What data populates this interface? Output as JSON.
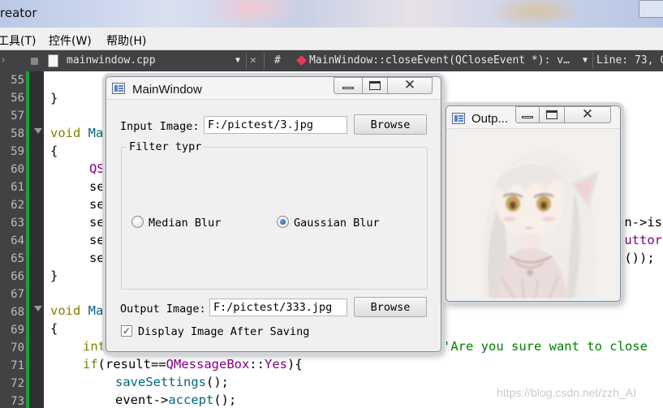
{
  "creator_window": {
    "title": "reator",
    "menu": [
      "工具(T)",
      "控件(W)",
      "帮助(H)"
    ],
    "editbar": {
      "file_name": "mainwindow.cpp",
      "hash": "#",
      "function_signature": "MainWindow::closeEvent(QCloseEvent *): v…",
      "line_info": "Line: 73, C"
    },
    "line_numbers": [
      "55",
      "56",
      "57",
      "58",
      "59",
      "60",
      "61",
      "62",
      "63",
      "64",
      "65",
      "66",
      "67",
      "68",
      "69",
      "70",
      "71",
      "72",
      "73"
    ],
    "code": {
      "l56": "}",
      "l58_kw": "void",
      "l58_rest": " Ma",
      "l59": "{",
      "l60": "QS",
      "l61": "se",
      "l62": "se",
      "l63": "se",
      "l63_tail": "on->is",
      "l64": "se",
      "l64_tail": "Buttor",
      "l65": "se",
      "l65_tail_fn": "d",
      "l65_tail": "());",
      "l66": "}",
      "l68_kw": "void",
      "l68_rest": " Ma",
      "l69": "{",
      "l70_kw": "int",
      "l70_str": "'Are you sure want to close",
      "l71_kw": "if",
      "l71_a": "(result==",
      "l71_cls": "QMessageBox",
      "l71_b": "::",
      "l71_yes": "Yes",
      "l71_c": "){",
      "l72_fn": "saveSettings",
      "l72_rest": "();",
      "l73_a": "event->",
      "l73_fn": "accept",
      "l73_rest": "();"
    },
    "watermark": "https://blog.csdn.net/zzh_AI"
  },
  "main_window": {
    "title": "MainWindow",
    "input_label": "Input Image:",
    "input_value": "F:/pictest/3.jpg",
    "browse_label": "Browse",
    "filter_group_title": "Filter typr",
    "median_label": "Median Blur",
    "gaussian_label": "Gaussian Blur",
    "selected_filter": "Gaussian Blur",
    "output_label": "Output Image:",
    "output_value": "F:/pictest/333.jpg",
    "browse_label_2": "Browse",
    "display_checkbox_label": "Display Image After Saving",
    "display_checked": true
  },
  "output_window": {
    "title": "Outp..."
  }
}
